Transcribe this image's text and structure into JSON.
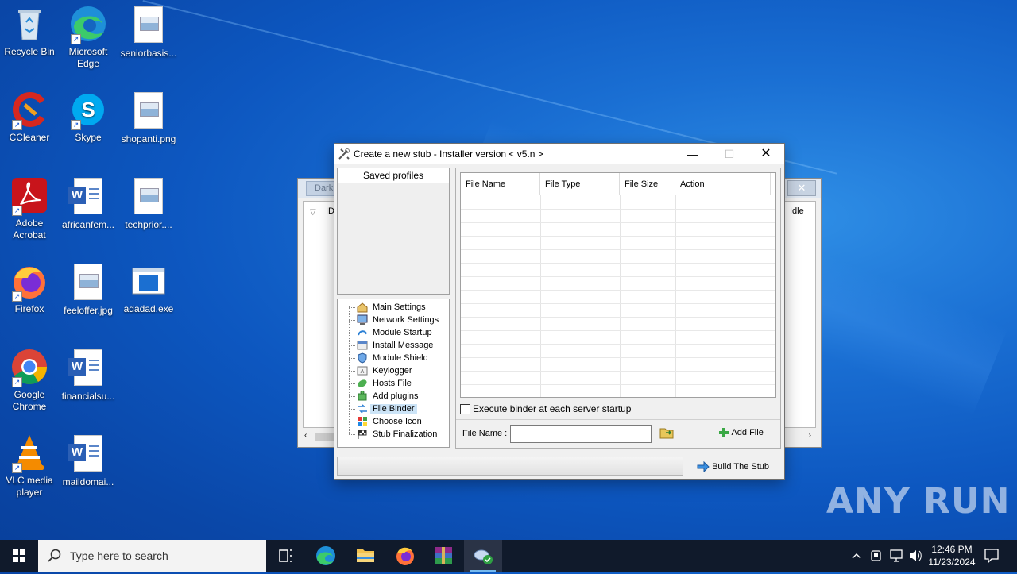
{
  "desktop": {
    "icons": [
      {
        "label": "Recycle Bin",
        "icon": "recycle-bin-icon"
      },
      {
        "label": "Microsoft\nEdge",
        "icon": "edge-icon"
      },
      {
        "label": "seniorbasis...",
        "icon": "image-file-icon"
      },
      {
        "label": "CCleaner",
        "icon": "ccleaner-icon"
      },
      {
        "label": "Skype",
        "icon": "skype-icon"
      },
      {
        "label": "shopanti.png",
        "icon": "image-file-icon"
      },
      {
        "label": "Adobe\nAcrobat",
        "icon": "acrobat-icon"
      },
      {
        "label": "africanfem...",
        "icon": "word-doc-icon"
      },
      {
        "label": "techprior....",
        "icon": "image-file-icon"
      },
      {
        "label": "Firefox",
        "icon": "firefox-icon"
      },
      {
        "label": "feeloffer.jpg",
        "icon": "image-file-icon"
      },
      {
        "label": "adadad.exe",
        "icon": "exe-file-icon"
      },
      {
        "label": "Google\nChrome",
        "icon": "chrome-icon"
      },
      {
        "label": "financialsu...",
        "icon": "word-doc-icon"
      },
      {
        "label": "VLC media\nplayer",
        "icon": "vlc-icon"
      },
      {
        "label": "maildomai...",
        "icon": "word-doc-icon"
      }
    ]
  },
  "bg_window": {
    "tab": "Dark",
    "col_id": "ID",
    "col_status": "Idle"
  },
  "dialog": {
    "title": "Create a new stub - Installer version < v5.n >",
    "saved_profiles": "Saved profiles",
    "tree": [
      "Main Settings",
      "Network Settings",
      "Module Startup",
      "Install Message",
      "Module Shield",
      "Keylogger",
      "Hosts File",
      "Add plugins",
      "File Binder",
      "Choose Icon",
      "Stub Finalization"
    ],
    "selected_tree_item": "File Binder",
    "grid_columns": [
      "File Name",
      "File Type",
      "File Size",
      "Action"
    ],
    "checkbox_label": "Execute binder at each server startup",
    "checkbox_checked": false,
    "file_name_label": "File Name :",
    "file_name_value": "",
    "add_file": "Add File",
    "build": "Build The Stub"
  },
  "taskbar": {
    "search_placeholder": "Type here to search",
    "time": "12:46 PM",
    "date": "11/23/2024"
  },
  "watermark": "ANY RUN"
}
